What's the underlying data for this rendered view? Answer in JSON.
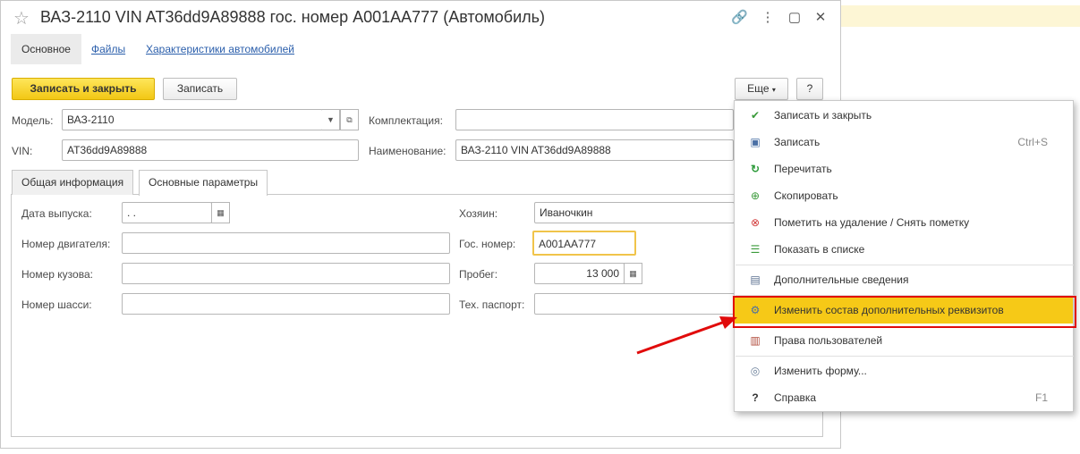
{
  "window": {
    "title": "ВАЗ-2110 VIN AT36dd9A89888 гос. номер А001АА777 (Автомобиль)",
    "icons": [
      "star-icon",
      "link-icon",
      "more-icon",
      "maximize-icon",
      "close-icon"
    ]
  },
  "nav": {
    "tabs": [
      "Основное",
      "Файлы",
      "Характеристики автомобилей"
    ]
  },
  "toolbar": {
    "save_close": "Записать и закрыть",
    "save": "Записать",
    "more": "Еще",
    "help": "?"
  },
  "header_fields": {
    "model_label": "Модель:",
    "model_value": "ВАЗ-2110",
    "vin_label": "VIN:",
    "vin_value": "AT36dd9A89888",
    "kompl_label": "Комплектация:",
    "kompl_value": "",
    "name_label": "Наименование:",
    "name_value": "ВАЗ-2110 VIN AT36dd9A89888"
  },
  "inner_tabs": [
    "Общая информация",
    "Основные параметры"
  ],
  "params": {
    "release_date_label": "Дата выпуска:",
    "release_date_value": " .  .",
    "engine_label": "Номер двигателя:",
    "engine_value": "",
    "body_label": "Номер кузова:",
    "body_value": "",
    "chassis_label": "Номер шасси:",
    "chassis_value": "",
    "owner_label": "Хозяин:",
    "owner_value": "Иваночкин",
    "plate_label": "Гос. номер:",
    "plate_value": "А001АА777",
    "mileage_label": "Пробег:",
    "mileage_value": "13 000",
    "passport_label": "Тех. паспорт:",
    "passport_value": ""
  },
  "menu": {
    "items": [
      {
        "label": "Записать и закрыть",
        "shortcut": "",
        "icon": "save-close-icon",
        "color": "#3a9a3a"
      },
      {
        "label": "Записать",
        "shortcut": "Ctrl+S",
        "icon": "floppy-icon",
        "color": "#4a6fa5"
      },
      {
        "label": "Перечитать",
        "shortcut": "",
        "icon": "refresh-icon",
        "color": "#2e9b3b"
      },
      {
        "label": "Скопировать",
        "shortcut": "",
        "icon": "copy-icon",
        "color": "#3a9a3a"
      },
      {
        "label": "Пометить на удаление / Снять пометку",
        "shortcut": "",
        "icon": "delete-mark-icon",
        "color": "#d23a3a"
      },
      {
        "label": "Показать в списке",
        "shortcut": "",
        "icon": "list-icon",
        "color": "#3a9a3a"
      },
      {
        "label": "Дополнительные сведения",
        "shortcut": "",
        "icon": "info-doc-icon",
        "color": "#5a6f90"
      },
      {
        "label": "Изменить состав дополнительных реквизитов",
        "shortcut": "",
        "icon": "settings-doc-icon",
        "color": "#4a6fa5"
      },
      {
        "label": "Права пользователей",
        "shortcut": "",
        "icon": "rights-icon",
        "color": "#b04a3a"
      },
      {
        "label": "Изменить форму...",
        "shortcut": "",
        "icon": "form-settings-icon",
        "color": "#6a7f99"
      },
      {
        "label": "Справка",
        "shortcut": "F1",
        "icon": "help-icon",
        "color": "#333333"
      }
    ]
  },
  "colors": {
    "accent_yellow": "#f6c917",
    "annotation_red": "#e10b0b",
    "link_blue": "#2a5eab"
  }
}
